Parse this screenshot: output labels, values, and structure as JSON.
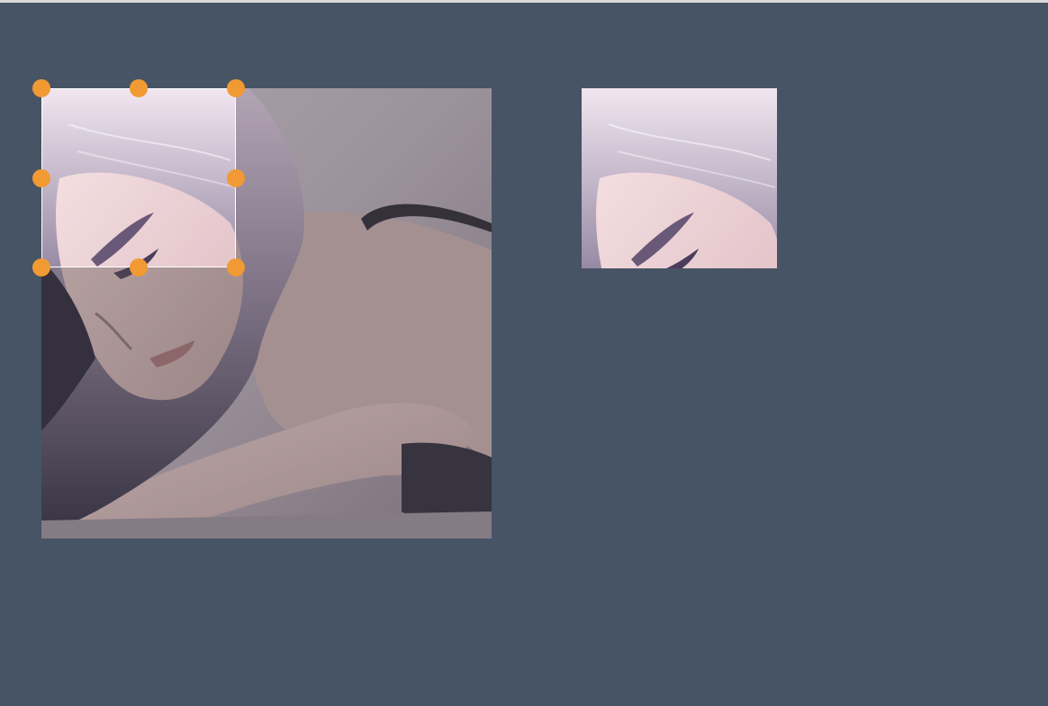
{
  "editor": {
    "source_image": "woman-lying-on-bed-photo",
    "selection_ratio": "free",
    "handle_color": "#f19a33",
    "background_color": "#475465"
  },
  "crop_selection": {
    "handles": [
      "top-left",
      "top-center",
      "top-right",
      "middle-left",
      "middle-right",
      "bottom-left",
      "bottom-center",
      "bottom-right"
    ]
  },
  "preview": {
    "content": "cropped-face-region"
  }
}
